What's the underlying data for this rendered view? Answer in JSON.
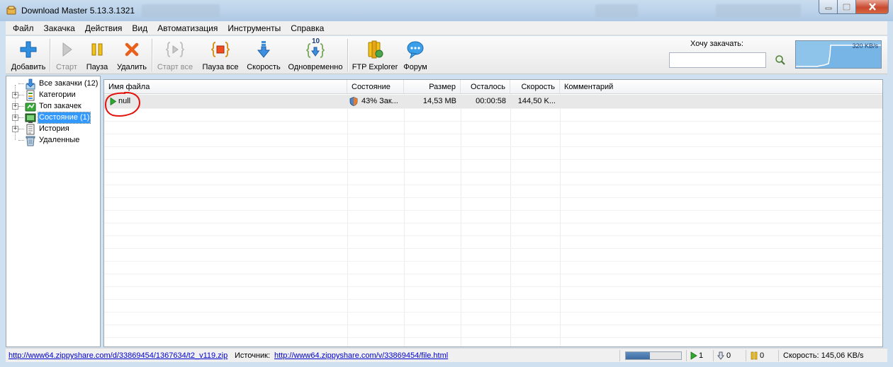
{
  "window": {
    "title": "Download Master 5.13.3.1321"
  },
  "menu": [
    "Файл",
    "Закачка",
    "Действия",
    "Вид",
    "Автоматизация",
    "Инструменты",
    "Справка"
  ],
  "toolbar": {
    "add": "Добавить",
    "start": "Старт",
    "pause": "Пауза",
    "delete": "Удалить",
    "start_all": "Старт все",
    "pause_all": "Пауза все",
    "speed": "Скорость",
    "simultaneous": "Одновременно",
    "simultaneous_badge": "10",
    "ftp_explorer": "FTP Explorer",
    "forum": "Форум",
    "want_download_label": "Хочу закачать:",
    "want_download_value": "",
    "graph_max": "320 KB/s"
  },
  "tree": {
    "items": [
      {
        "label": "Все закачки (12)",
        "icon": "downloads-icon"
      },
      {
        "label": "Категории",
        "icon": "categories-icon"
      },
      {
        "label": "Топ закачек",
        "icon": "top-downloads-icon"
      },
      {
        "label": "Состояние (1)",
        "icon": "status-icon"
      },
      {
        "label": "История",
        "icon": "history-icon"
      },
      {
        "label": "Удаленные",
        "icon": "trash-icon"
      }
    ]
  },
  "list": {
    "columns": [
      "Имя файла",
      "Состояние",
      "Размер",
      "Осталось",
      "Скорость",
      "Комментарий"
    ],
    "rows": [
      {
        "name": "null",
        "status": "43% Зак...",
        "size": "14,53 MB",
        "remaining": "00:00:58",
        "speed": "144,50 K...",
        "comment": ""
      }
    ]
  },
  "statusbar": {
    "url": "http://www64.zippyshare.com/d/33869454/1367634/t2_v119.zip",
    "source_label": "Источник:",
    "source_url": "http://www64.zippyshare.com/v/33869454/file.html",
    "active_count": "1",
    "queued_count": "0",
    "paused_count": "0",
    "speed": "Скорость: 145,06 KB/s",
    "progress": 0.43
  },
  "colors": {
    "accent": "#3399ff",
    "play_green": "#2eaa2e",
    "link": "#0000cc",
    "annotation": "#e3120b"
  }
}
